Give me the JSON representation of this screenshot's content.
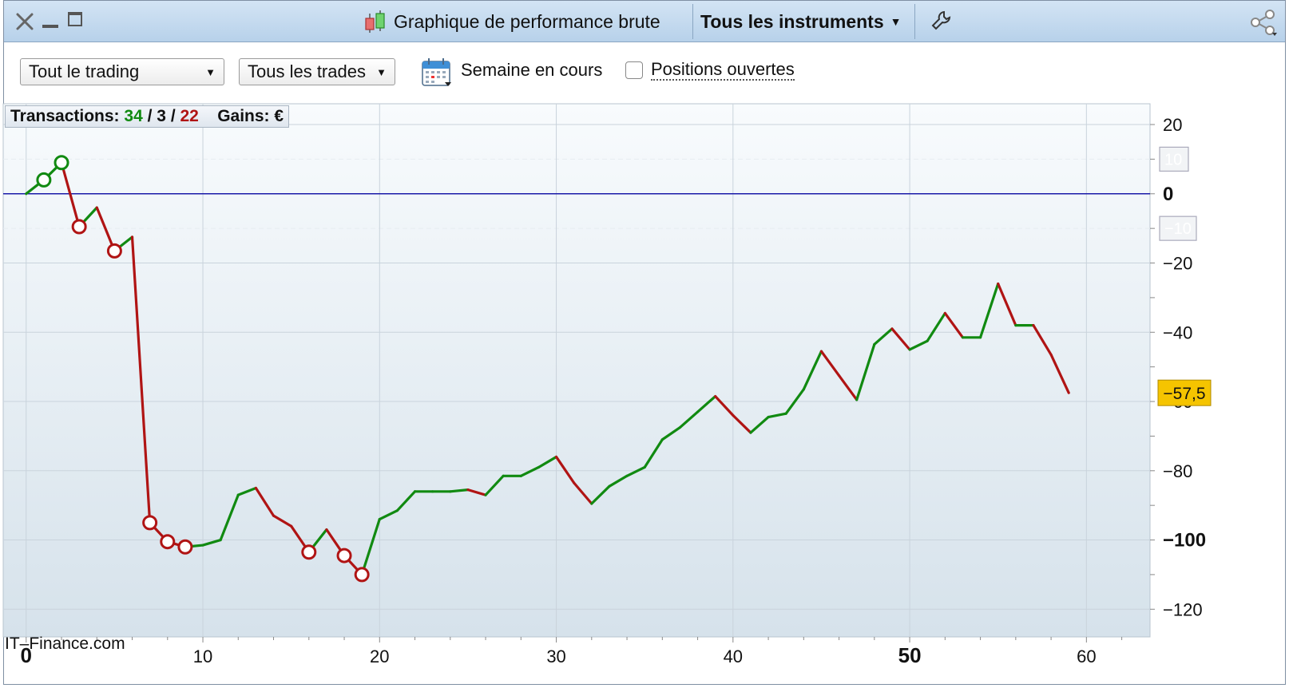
{
  "window": {
    "title": "Graphique de performance brute",
    "instruments_label": "Tous les instruments"
  },
  "toolbar": {
    "trading_select": "Tout le trading",
    "trades_select": "Tous les trades",
    "week_label": "Semaine en cours",
    "open_positions_label": "Positions ouvertes"
  },
  "stats": {
    "transactions_label": "Transactions:",
    "wins": "34",
    "sep1": "/",
    "neutral": "3",
    "sep2": "/",
    "losses": "22",
    "gains_label": "Gains: €"
  },
  "watermark": "IT–Finance.com",
  "colors": {
    "gain": "#118a11",
    "loss": "#b01414",
    "zero_line": "#1a1aa8",
    "current_badge": "#f5c400",
    "titlebar": "#c2d8ee"
  },
  "chart_data": {
    "type": "line",
    "x": [
      0,
      1,
      2,
      3,
      4,
      5,
      6,
      7,
      8,
      9,
      10,
      11,
      12,
      13,
      14,
      15,
      16,
      17,
      18,
      19,
      20,
      21,
      22,
      23,
      24,
      25,
      26,
      27,
      28,
      29,
      30,
      31,
      32,
      33,
      34,
      35,
      36,
      37,
      38,
      39,
      40,
      41,
      42,
      43,
      44,
      45,
      46,
      47,
      48,
      49,
      50,
      51,
      52,
      53,
      54,
      55,
      56,
      57,
      58,
      59
    ],
    "y": [
      0,
      4,
      9,
      -9.5,
      -4,
      -16.5,
      -12.5,
      -95,
      -100.5,
      -102,
      -101.5,
      -100,
      -87,
      -85,
      -93,
      -96,
      -103.5,
      -97,
      -104.5,
      -110,
      -94,
      -91.5,
      -86,
      -86,
      -86,
      -85.5,
      -87,
      -81.5,
      -81.5,
      -79,
      -76,
      -83.5,
      -89.5,
      -84.5,
      -81.5,
      -79,
      -71,
      -67.5,
      -63,
      -58.5,
      -64,
      -69,
      -64.5,
      -63.5,
      -56.5,
      -45.5,
      -52.5,
      -59.5,
      -43.5,
      -39,
      -45,
      -42.5,
      -34.5,
      -41.5,
      -41.5,
      -26,
      -38,
      -38,
      -46.5,
      -57.5
    ],
    "loss_markers_x": [
      3,
      5,
      7,
      8,
      9,
      16,
      18,
      19
    ],
    "win_markers_x": [
      1,
      2
    ],
    "x_ticks": [
      "0",
      "10",
      "20",
      "30",
      "40",
      "50",
      "60"
    ],
    "x_range": [
      -1.3,
      63.6
    ],
    "y_ticks": [
      "20",
      "0",
      "-20",
      "-40",
      "-60",
      "-80",
      "-100",
      "-120"
    ],
    "y_range": [
      -128,
      26
    ],
    "minor_y_labels": [
      "10",
      "-10"
    ],
    "current_value_label": "-57,5",
    "grid": true
  }
}
